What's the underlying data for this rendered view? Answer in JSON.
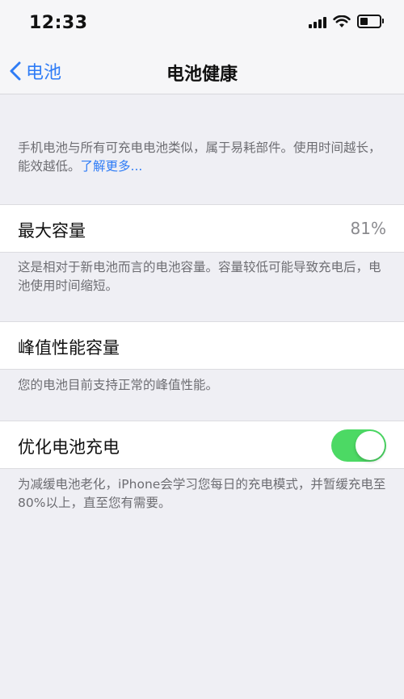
{
  "status_bar": {
    "time": "12:33",
    "icons": [
      "cellular-signal-icon",
      "wifi-icon",
      "battery-icon"
    ]
  },
  "nav": {
    "back_label": "电池",
    "title": "电池健康"
  },
  "intro": {
    "text": "手机电池与所有可充电电池类似，属于易耗部件。使用时间越长，能效越低。",
    "link": "了解更多..."
  },
  "max_capacity": {
    "label": "最大容量",
    "value": "81%",
    "footer": "这是相对于新电池而言的电池容量。容量较低可能导致充电后，电池使用时间缩短。"
  },
  "peak_performance": {
    "label": "峰值性能容量",
    "footer": "您的电池目前支持正常的峰值性能。"
  },
  "optimized_charging": {
    "label": "优化电池充电",
    "enabled": true,
    "footer": "为减缓电池老化，iPhone会学习您每日的充电模式，并暂缓充电至80%以上，直至您有需要。"
  },
  "colors": {
    "accent": "#2f7cf6",
    "toggle_on": "#4cd964",
    "background": "#efeff4",
    "secondary_text": "#6d6d72"
  }
}
